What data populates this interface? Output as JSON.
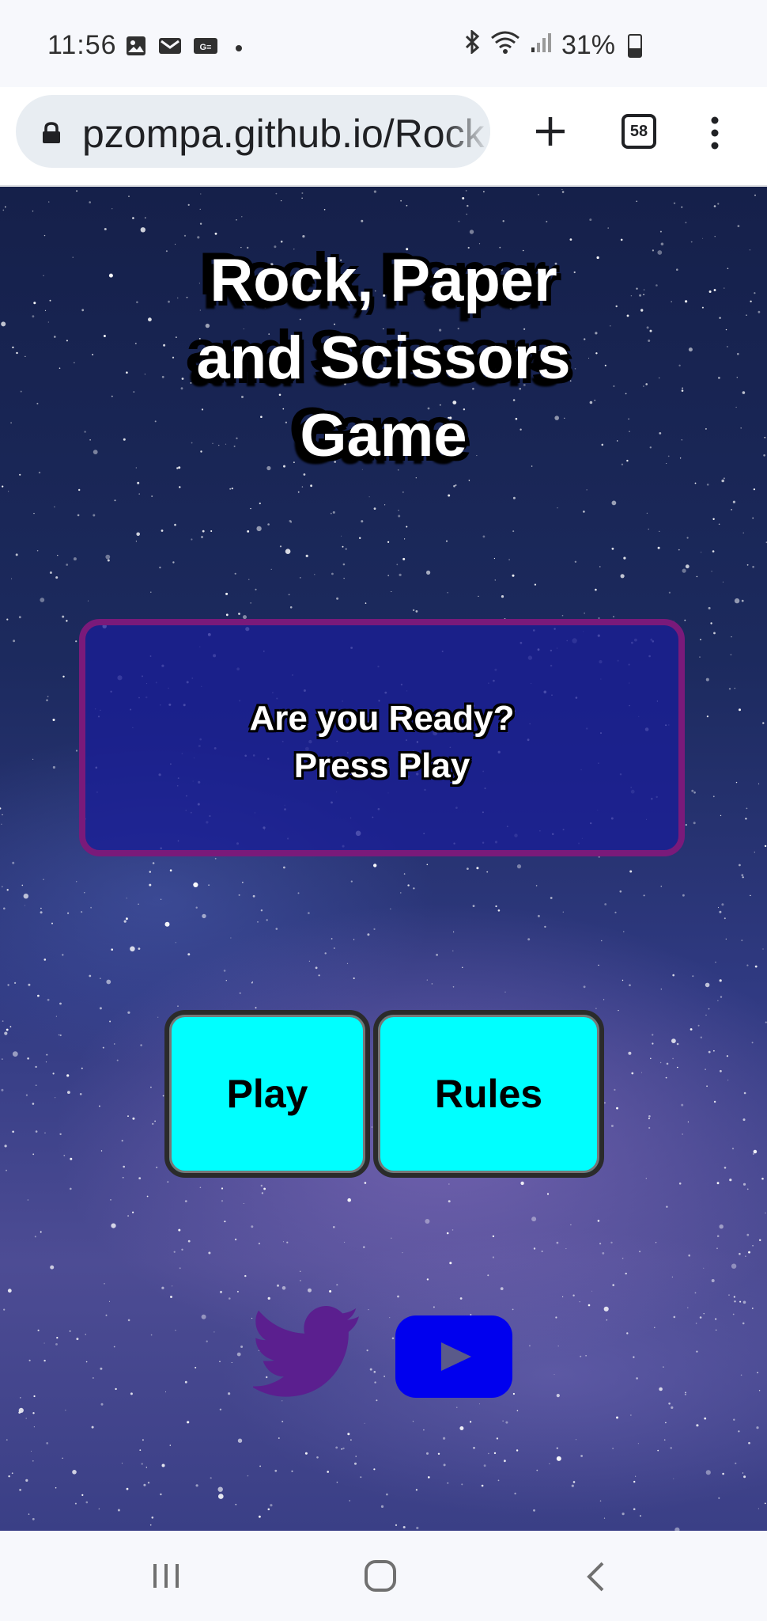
{
  "status_bar": {
    "time": "11:56",
    "battery": "31%",
    "icons": [
      "image-icon",
      "gmail-icon",
      "ge-icon",
      "bluetooth-icon",
      "wifi-icon",
      "signal-icon",
      "battery-icon"
    ]
  },
  "browser": {
    "url": "pzompa.github.io/Rock",
    "tab_count": "58"
  },
  "page": {
    "title": "Rock, Paper\nand Scissors\nGame",
    "message_line1": "Are you Ready?",
    "message_line2": "Press Play",
    "play_label": "Play",
    "rules_label": "Rules"
  },
  "colors": {
    "button_bg": "#00ffff",
    "message_border": "#7a1a7a",
    "message_bg": "#1e2396",
    "twitter": "#5b1f8f",
    "youtube": "#0000ee"
  }
}
